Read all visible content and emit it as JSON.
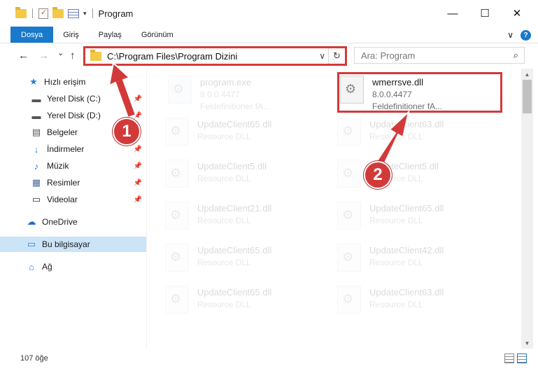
{
  "titlebar": {
    "title": "Program",
    "minimize": "—",
    "maximize": "☐",
    "close": "✕"
  },
  "ribbon": {
    "tabs": [
      "Dosya",
      "Giriş",
      "Paylaş",
      "Görünüm"
    ],
    "expand_icon": "∨",
    "help": "?"
  },
  "nav": {
    "back": "←",
    "forward": "→",
    "recent": "⌄",
    "up": "↑"
  },
  "address": {
    "path": "C:\\Program Files\\Program Dizini",
    "chevron": "∨",
    "refresh": "↻"
  },
  "search": {
    "placeholder": "Ara: Program",
    "icon": "⌕"
  },
  "sidebar": {
    "items": [
      {
        "label": "Hızlı erişim",
        "icon": "★"
      },
      {
        "label": "Yerel Disk (C:)",
        "icon": "▬"
      },
      {
        "label": "Yerel Disk (D:)",
        "icon": "▬"
      },
      {
        "label": "Belgeler",
        "icon": "▤"
      },
      {
        "label": "İndirmeler",
        "icon": "↓"
      },
      {
        "label": "Müzik",
        "icon": "♪"
      },
      {
        "label": "Resimler",
        "icon": "▦"
      },
      {
        "label": "Videolar",
        "icon": "▭"
      },
      {
        "label": "OneDrive",
        "icon": "☁"
      },
      {
        "label": "Bu bilgisayar",
        "icon": "▭"
      },
      {
        "label": "Ağ",
        "icon": "⌂"
      }
    ],
    "pin": "📌"
  },
  "files": [
    {
      "name": "program.exe",
      "line2": "8.0.0.4477",
      "line3": "Feldefinitioner fA..."
    },
    {
      "name": "wmerrsve.dll",
      "line2": "8.0.0.4477",
      "line3": "Feldefinitioner fA..."
    },
    {
      "name": "UpdateClient65.dll",
      "line2": "Resource DLL"
    },
    {
      "name": "UpdateClient63.dll",
      "line2": "Resource DLL"
    },
    {
      "name": "UpdateClient5.dll",
      "line2": "Resource DLL"
    },
    {
      "name": "UpdateClient5.dll",
      "line2": "Resource DLL"
    },
    {
      "name": "UpdateClient21.dll",
      "line2": "Resource DLL"
    },
    {
      "name": "UpdateClient65.dll",
      "line2": "Resource DLL"
    },
    {
      "name": "UpdateClient65.dll",
      "line2": "Resource DLL"
    },
    {
      "name": "UpdateClient42.dll",
      "line2": "Resource DLL"
    },
    {
      "name": "UpdateClient65.dll",
      "line2": "Resource DLL"
    },
    {
      "name": "UpdateClient63.dll",
      "line2": "Resource DLL"
    }
  ],
  "status": {
    "count": "107 öğe"
  },
  "annotations": {
    "badge1": "1",
    "badge2": "2",
    "color": "#d23a3a"
  }
}
